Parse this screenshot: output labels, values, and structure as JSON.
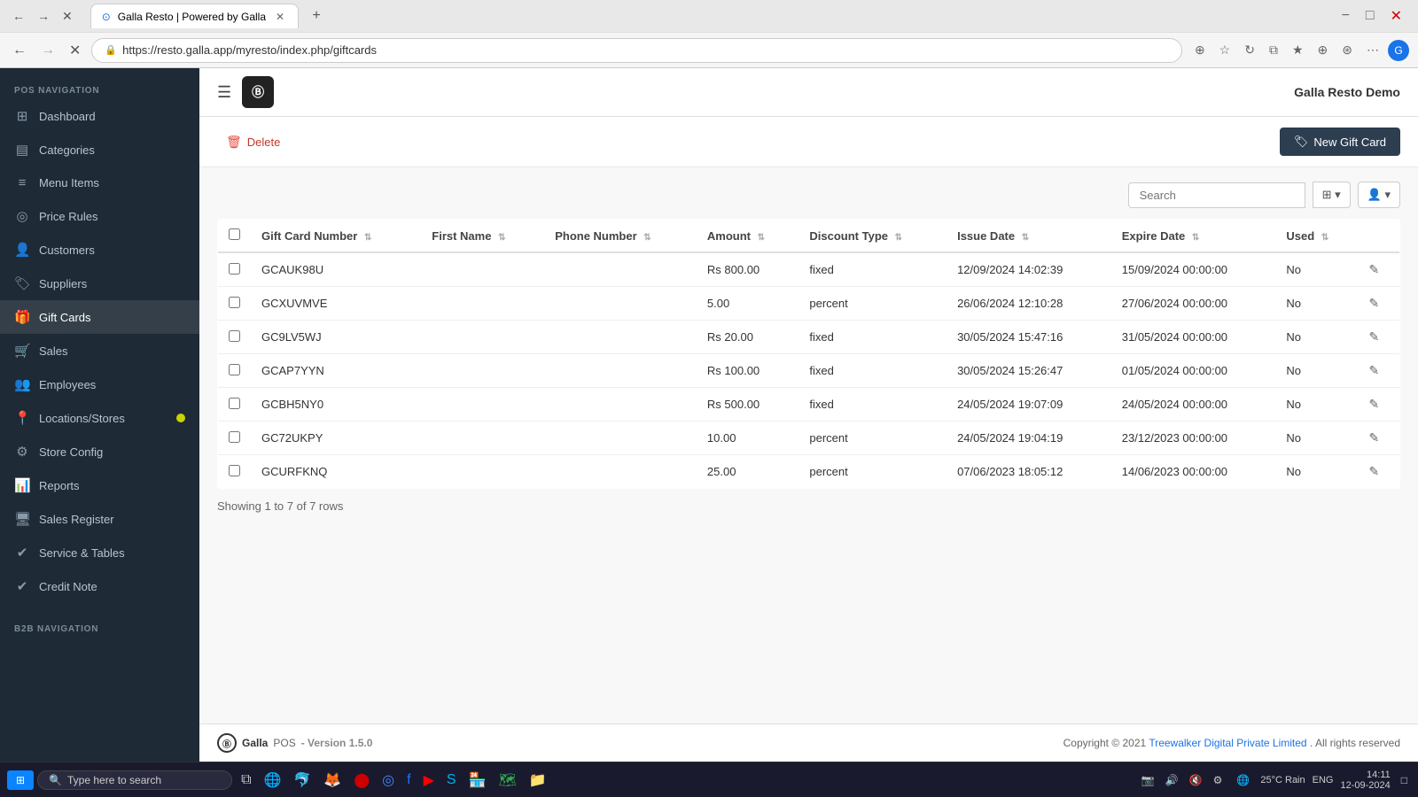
{
  "browser": {
    "tab_title": "Galla Resto | Powered by Galla",
    "url": "https://resto.galla.app/myresto/index.php/giftcards",
    "profile_letter": "G"
  },
  "topbar": {
    "app_name": "Galla Resto Demo"
  },
  "logo": {
    "symbol": "Ⓑ"
  },
  "sidebar": {
    "pos_nav_label": "POS NAVIGATION",
    "b2b_nav_label": "B2B NAVIGATION",
    "items": [
      {
        "id": "dashboard",
        "label": "Dashboard",
        "icon": "⊞"
      },
      {
        "id": "categories",
        "label": "Categories",
        "icon": "▤"
      },
      {
        "id": "menu-items",
        "label": "Menu Items",
        "icon": "☰"
      },
      {
        "id": "price-rules",
        "label": "Price Rules",
        "icon": "⊙"
      },
      {
        "id": "customers",
        "label": "Customers",
        "icon": "👤"
      },
      {
        "id": "suppliers",
        "label": "Suppliers",
        "icon": "🏷"
      },
      {
        "id": "gift-cards",
        "label": "Gift Cards",
        "icon": "🎁",
        "active": true
      },
      {
        "id": "sales",
        "label": "Sales",
        "icon": "🛒"
      },
      {
        "id": "employees",
        "label": "Employees",
        "icon": "👥"
      },
      {
        "id": "locations",
        "label": "Locations/Stores",
        "icon": "📍",
        "badge": true
      },
      {
        "id": "store-config",
        "label": "Store Config",
        "icon": "⚙"
      },
      {
        "id": "reports",
        "label": "Reports",
        "icon": "📊"
      },
      {
        "id": "sales-register",
        "label": "Sales Register",
        "icon": "🖥"
      },
      {
        "id": "service-tables",
        "label": "Service & Tables",
        "icon": "✔"
      },
      {
        "id": "credit-note",
        "label": "Credit Note",
        "icon": "✔"
      }
    ]
  },
  "actions": {
    "delete_label": "Delete",
    "new_gift_card_label": "New Gift Card",
    "search_placeholder": "Search"
  },
  "table": {
    "columns": [
      {
        "id": "gift_card_number",
        "label": "Gift Card Number"
      },
      {
        "id": "first_name",
        "label": "First Name"
      },
      {
        "id": "phone_number",
        "label": "Phone Number"
      },
      {
        "id": "amount",
        "label": "Amount"
      },
      {
        "id": "discount_type",
        "label": "Discount Type"
      },
      {
        "id": "issue_date",
        "label": "Issue Date"
      },
      {
        "id": "expire_date",
        "label": "Expire Date"
      },
      {
        "id": "used",
        "label": "Used"
      }
    ],
    "rows": [
      {
        "gift_card_number": "GCAUK98U",
        "first_name": "",
        "phone_number": "",
        "amount": "Rs 800.00",
        "discount_type": "fixed",
        "issue_date": "12/09/2024 14:02:39",
        "expire_date": "15/09/2024 00:00:00",
        "used": "No"
      },
      {
        "gift_card_number": "GCXUVMVE",
        "first_name": "",
        "phone_number": "",
        "amount": "5.00",
        "discount_type": "percent",
        "issue_date": "26/06/2024 12:10:28",
        "expire_date": "27/06/2024 00:00:00",
        "used": "No"
      },
      {
        "gift_card_number": "GC9LV5WJ",
        "first_name": "",
        "phone_number": "",
        "amount": "Rs 20.00",
        "discount_type": "fixed",
        "issue_date": "30/05/2024 15:47:16",
        "expire_date": "31/05/2024 00:00:00",
        "used": "No"
      },
      {
        "gift_card_number": "GCAP7YYN",
        "first_name": "",
        "phone_number": "",
        "amount": "Rs 100.00",
        "discount_type": "fixed",
        "issue_date": "30/05/2024 15:26:47",
        "expire_date": "01/05/2024 00:00:00",
        "used": "No"
      },
      {
        "gift_card_number": "GCBH5NY0",
        "first_name": "",
        "phone_number": "",
        "amount": "Rs 500.00",
        "discount_type": "fixed",
        "issue_date": "24/05/2024 19:07:09",
        "expire_date": "24/05/2024 00:00:00",
        "used": "No"
      },
      {
        "gift_card_number": "GC72UKPY",
        "first_name": "",
        "phone_number": "",
        "amount": "10.00",
        "discount_type": "percent",
        "issue_date": "24/05/2024 19:04:19",
        "expire_date": "23/12/2023 00:00:00",
        "used": "No"
      },
      {
        "gift_card_number": "GCURFKNQ",
        "first_name": "",
        "phone_number": "",
        "amount": "25.00",
        "discount_type": "percent",
        "issue_date": "07/06/2023 18:05:12",
        "expire_date": "14/06/2023 00:00:00",
        "used": "No"
      }
    ],
    "row_count_text": "Showing 1 to 7 of 7 rows"
  },
  "footer": {
    "logo_symbol": "Ⓑ",
    "brand": "Galla",
    "pos_label": "POS",
    "version": "- Version 1.5.0",
    "copyright": "Copyright © 2021",
    "company_link": "Treewalker Digital Private Limited",
    "rights": ". All rights reserved"
  },
  "taskbar": {
    "start_label": "⊞",
    "search_placeholder": "Type here to search",
    "time": "14:11",
    "date": "12-09-2024",
    "weather": "25°C  Rain",
    "lang": "ENG"
  }
}
